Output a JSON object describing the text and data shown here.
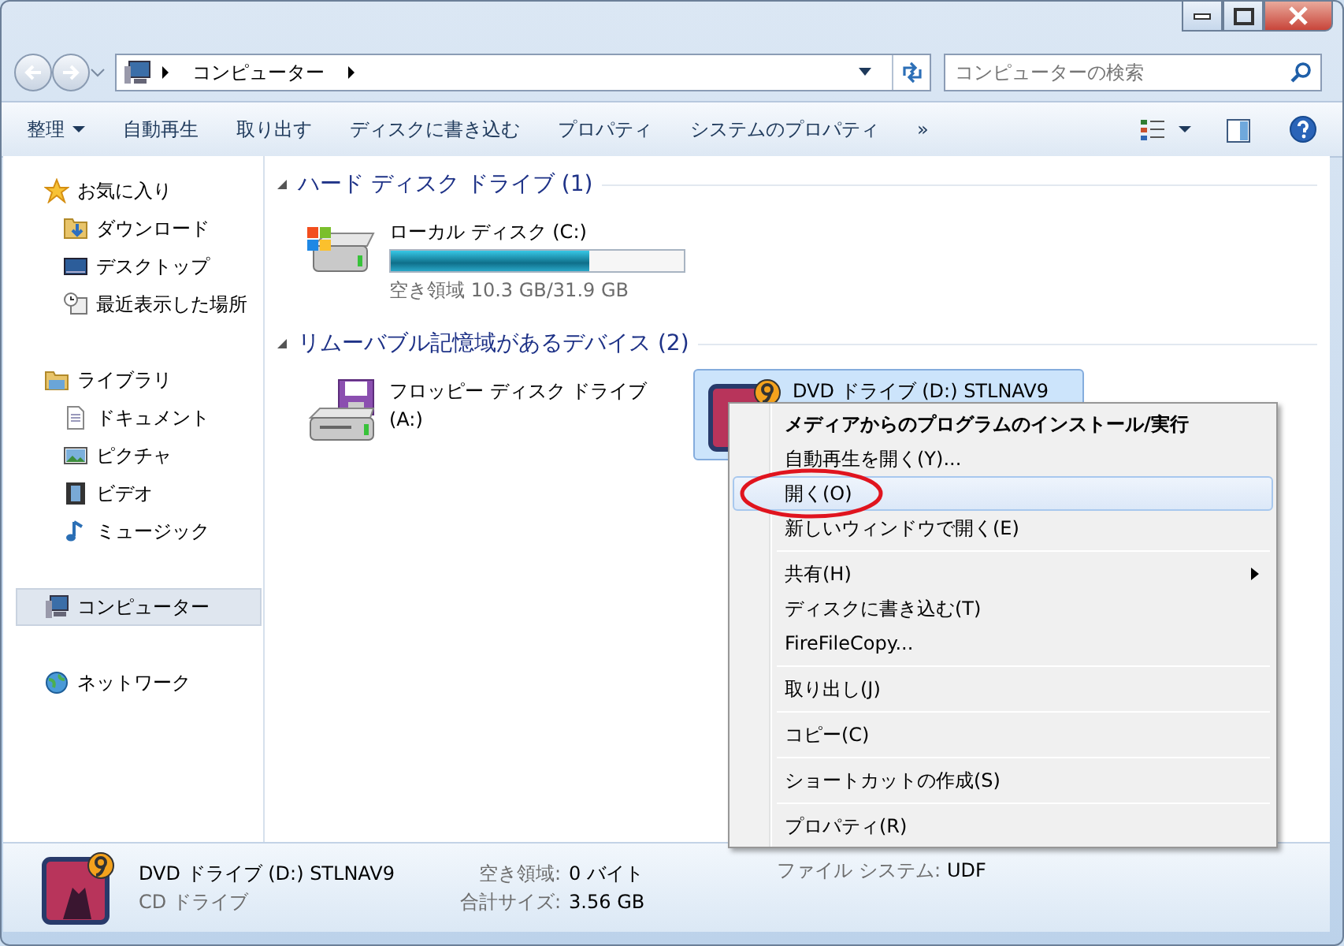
{
  "address_bar": {
    "path": [
      "コンピューター"
    ],
    "search_placeholder": "コンピューターの検索"
  },
  "toolbar": {
    "buttons": [
      {
        "label": "整理",
        "dropdown": true
      },
      {
        "label": "自動再生",
        "dropdown": false
      },
      {
        "label": "取り出す",
        "dropdown": false
      },
      {
        "label": "ディスクに書き込む",
        "dropdown": false
      },
      {
        "label": "プロパティ",
        "dropdown": false
      },
      {
        "label": "システムのプロパティ",
        "dropdown": false
      },
      {
        "label": "»",
        "dropdown": false
      }
    ]
  },
  "sidebar": {
    "groups": [
      {
        "label": "お気に入り",
        "selected": false,
        "children": [
          {
            "label": "ダウンロード",
            "selected": false
          },
          {
            "label": "デスクトップ",
            "selected": false
          },
          {
            "label": "最近表示した場所",
            "selected": false
          }
        ]
      },
      {
        "label": "ライブラリ",
        "selected": false,
        "children": [
          {
            "label": "ドキュメント",
            "selected": false
          },
          {
            "label": "ピクチャ",
            "selected": false
          },
          {
            "label": "ビデオ",
            "selected": false
          },
          {
            "label": "ミュージック",
            "selected": false
          }
        ]
      },
      {
        "label": "コンピューター",
        "selected": true
      },
      {
        "label": "ネットワーク",
        "selected": false
      }
    ]
  },
  "sections": [
    {
      "title": "ハード ディスク ドライブ (1)",
      "expanded": true,
      "drives": [
        {
          "kind": "hdd",
          "name": "ローカル ディスク (C:)",
          "level": 0.68,
          "info": "空き領域 10.3 GB/31.9 GB",
          "selected": false
        }
      ]
    },
    {
      "title": "リムーバブル記憶域があるデバイス (2)",
      "expanded": true,
      "drives": [
        {
          "kind": "floppy",
          "name": "フロッピー ディスク ドライブ (A:)",
          "selected": false
        },
        {
          "kind": "dvd",
          "name": "DVD ドライブ (D:) STLNAV9",
          "selected": true
        }
      ]
    }
  ],
  "context_menu": {
    "items": [
      {
        "kind": "item",
        "label": "メディアからのプログラムのインストール/実行",
        "default": true,
        "highlighted": false,
        "submenu": false,
        "circled": false
      },
      {
        "kind": "item",
        "label": "自動再生を開く(Y)...",
        "default": false,
        "highlighted": false,
        "submenu": false,
        "circled": false
      },
      {
        "kind": "item",
        "label": "開く(O)",
        "default": false,
        "highlighted": true,
        "submenu": false,
        "circled": true
      },
      {
        "kind": "item",
        "label": "新しいウィンドウで開く(E)",
        "default": false,
        "highlighted": false,
        "submenu": false,
        "circled": false
      },
      {
        "kind": "separator"
      },
      {
        "kind": "item",
        "label": "共有(H)",
        "default": false,
        "highlighted": false,
        "submenu": true,
        "circled": false
      },
      {
        "kind": "item",
        "label": "ディスクに書き込む(T)",
        "default": false,
        "highlighted": false,
        "submenu": false,
        "circled": false
      },
      {
        "kind": "item",
        "label": "FireFileCopy...",
        "default": false,
        "highlighted": false,
        "submenu": false,
        "circled": false
      },
      {
        "kind": "separator"
      },
      {
        "kind": "item",
        "label": "取り出し(J)",
        "default": false,
        "highlighted": false,
        "submenu": false,
        "circled": false
      },
      {
        "kind": "separator"
      },
      {
        "kind": "item",
        "label": "コピー(C)",
        "default": false,
        "highlighted": false,
        "submenu": false,
        "circled": false
      },
      {
        "kind": "separator"
      },
      {
        "kind": "item",
        "label": "ショートカットの作成(S)",
        "default": false,
        "highlighted": false,
        "submenu": false,
        "circled": false
      },
      {
        "kind": "separator"
      },
      {
        "kind": "item",
        "label": "プロパティ(R)",
        "default": false,
        "highlighted": false,
        "submenu": false,
        "circled": false
      }
    ]
  },
  "details_pane": {
    "name": "DVD ドライブ (D:) STLNAV9",
    "type": "CD ドライブ",
    "fields": [
      {
        "label": "空き領域:",
        "value": "0 バイト"
      },
      {
        "label": "合計サイズ:",
        "value": "3.56 GB"
      },
      {
        "label": "ファイル システム:",
        "value": "UDF"
      }
    ]
  }
}
